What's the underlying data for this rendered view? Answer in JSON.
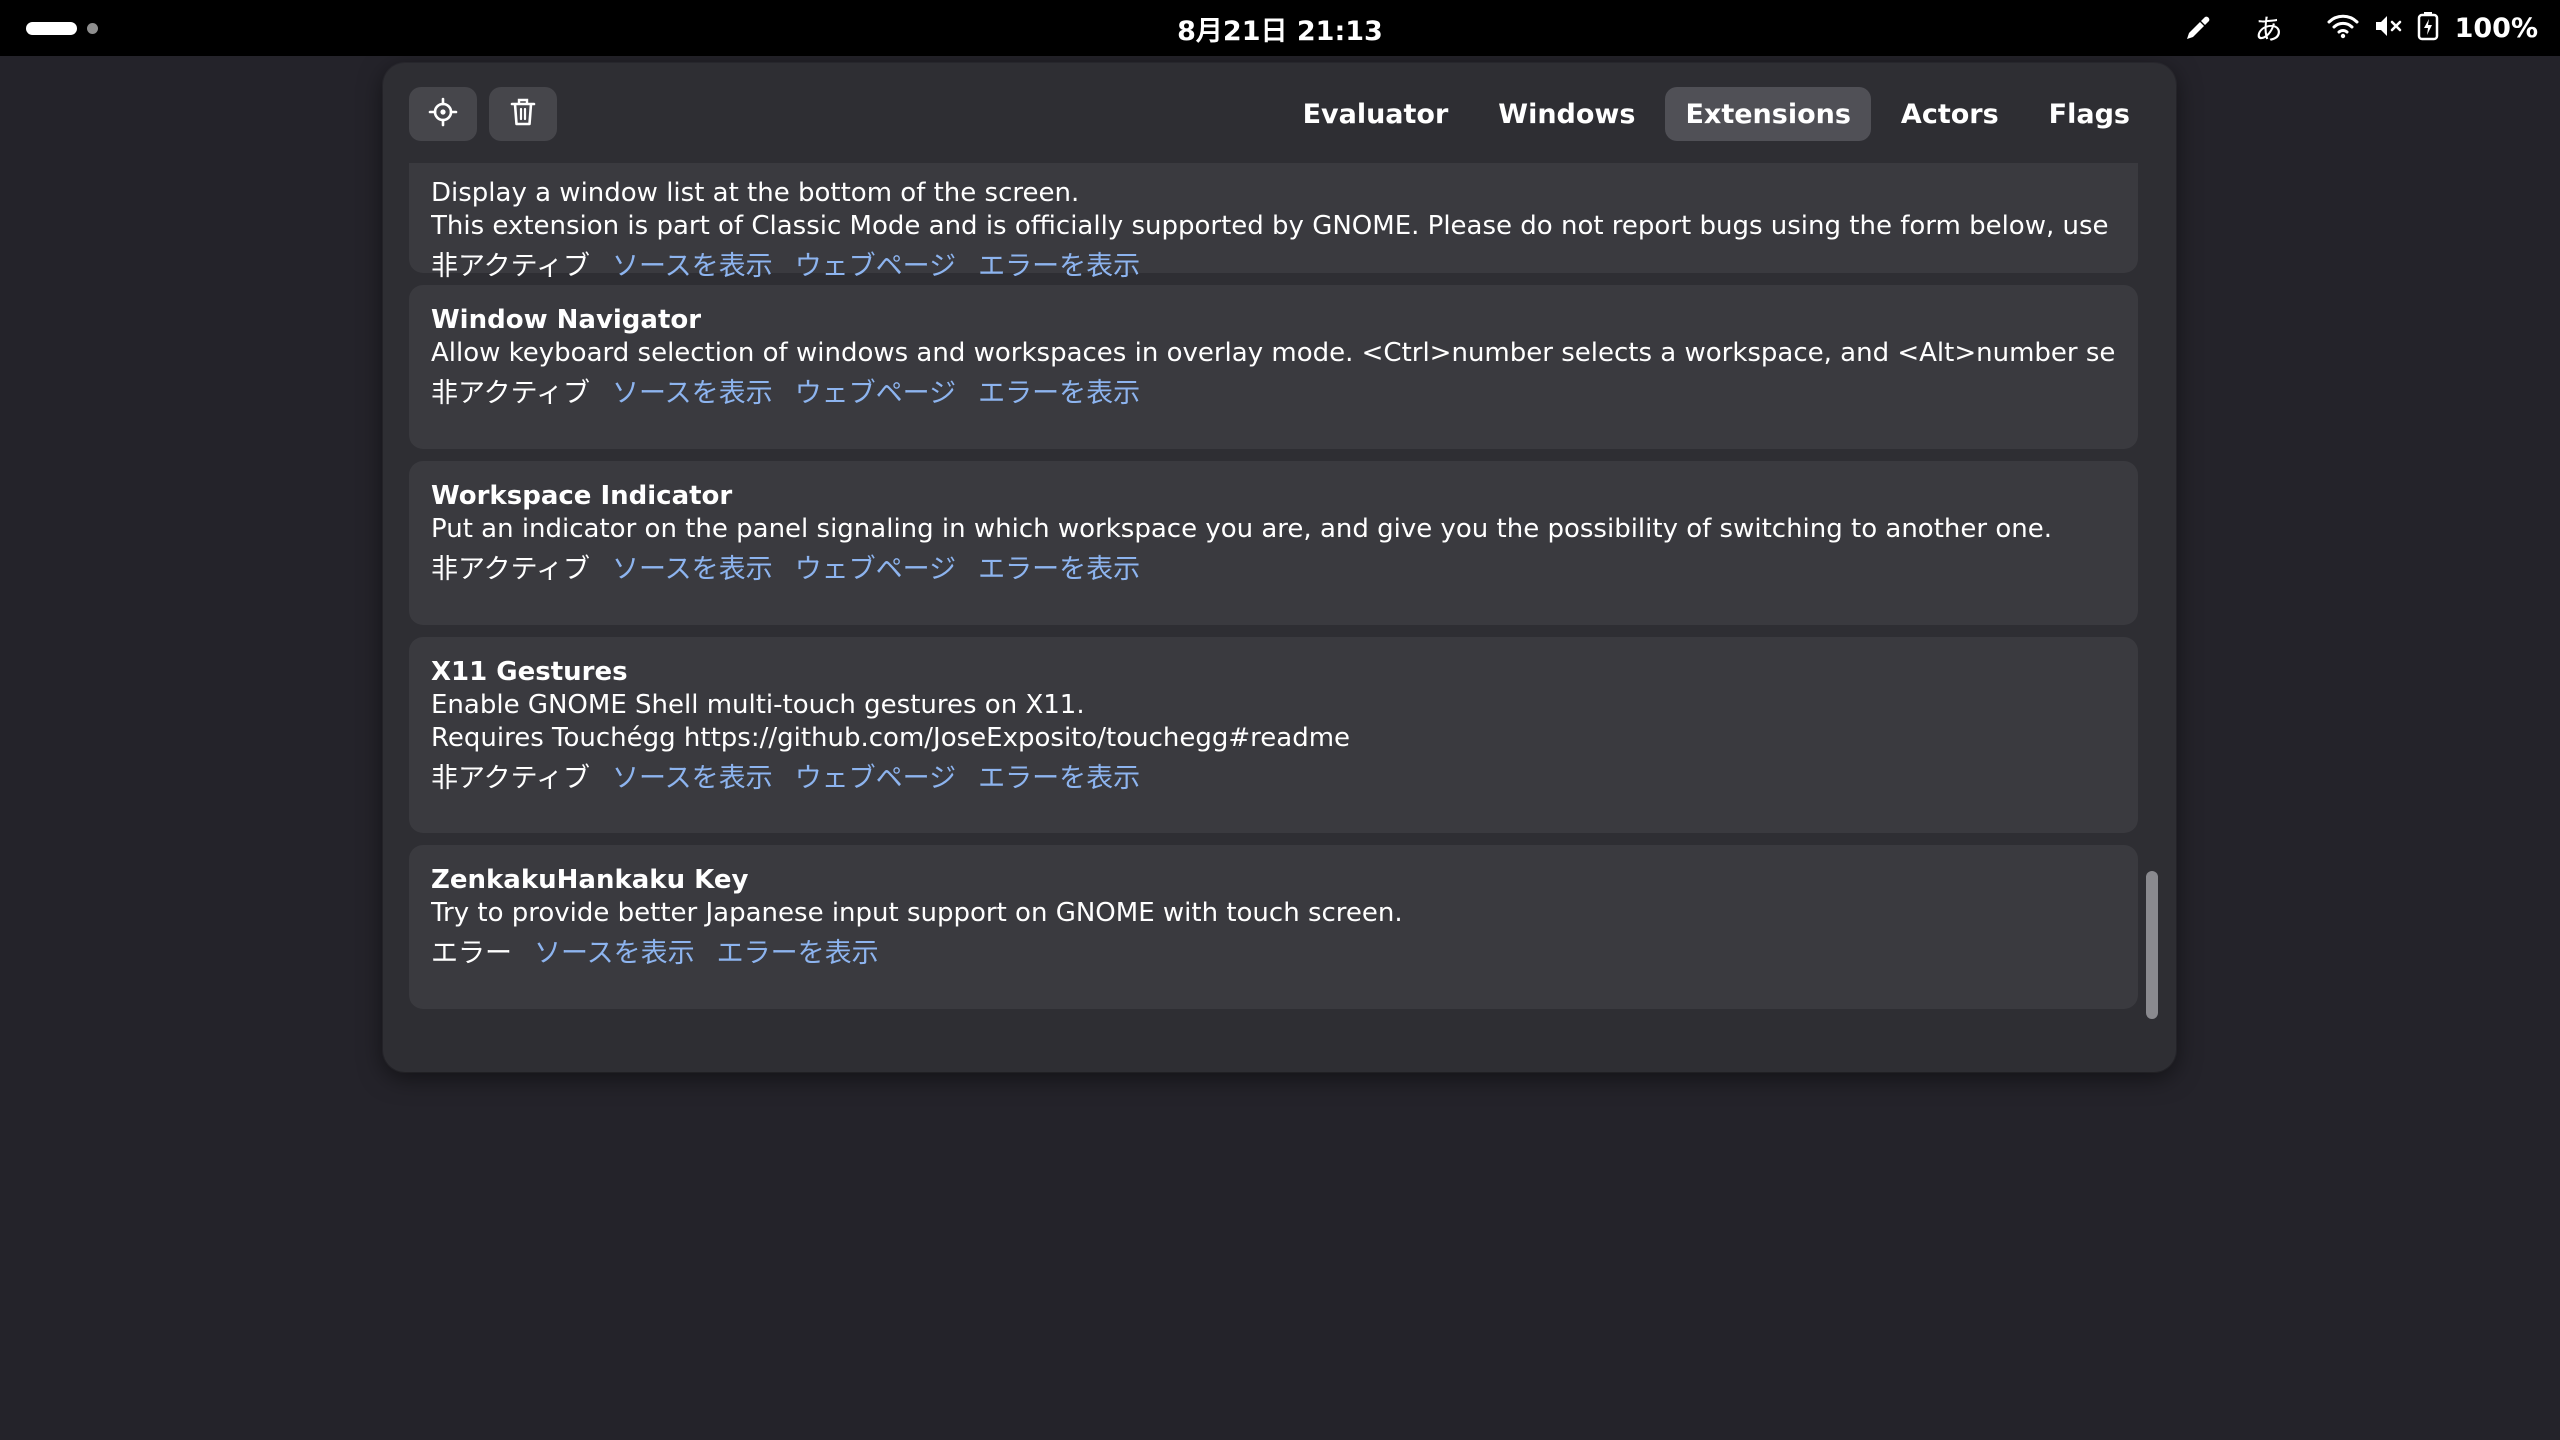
{
  "topbar": {
    "clock": "8月21日  21:13",
    "ime_indicator": "あ",
    "battery_percent": "100%",
    "icons": [
      "workspace-indicator",
      "color-picker-icon",
      "wifi-icon",
      "volume-muted-icon",
      "battery-charging-icon"
    ]
  },
  "lg": {
    "toolbar": {
      "picker_icon": "crosshair-icon",
      "clear_icon": "trash-icon"
    },
    "tabs": [
      {
        "label": "Evaluator"
      },
      {
        "label": "Windows"
      },
      {
        "label": "Extensions",
        "active": true
      },
      {
        "label": "Actors"
      },
      {
        "label": "Flags"
      }
    ],
    "extensions": [
      {
        "title": "",
        "desc1": "Display a window list at the bottom of the screen.",
        "desc2": "This extension is part of Classic Mode and is officially supported by GNOME. Please do not report bugs using the form below, use GNOME's ...",
        "state": "非アクティブ",
        "view_source": "ソースを表示",
        "webpage": "ウェブページ",
        "show_errors": "エラーを表示"
      },
      {
        "title": "Window Navigator",
        "desc1": "Allow keyboard selection of windows and workspaces in overlay mode. <Ctrl>number selects a workspace, and <Alt>number selects a windo...",
        "state": "非アクティブ",
        "view_source": "ソースを表示",
        "webpage": "ウェブページ",
        "show_errors": "エラーを表示"
      },
      {
        "title": "Workspace Indicator",
        "desc1": "Put an indicator on the panel signaling in which workspace you are, and give you the possibility of switching to another one.",
        "state": "非アクティブ",
        "view_source": "ソースを表示",
        "webpage": "ウェブページ",
        "show_errors": "エラーを表示"
      },
      {
        "title": "X11 Gestures",
        "desc1": "Enable GNOME Shell multi-touch gestures on X11.",
        "desc2": "Requires Touchégg https://github.com/JoseExposito/touchegg#readme",
        "state": "非アクティブ",
        "view_source": "ソースを表示",
        "webpage": "ウェブページ",
        "show_errors": "エラーを表示"
      },
      {
        "title": "ZenkakuHankaku Key",
        "desc1": "Try to provide better Japanese input support on GNOME with touch screen.",
        "state": "エラー",
        "view_source": "ソースを表示",
        "show_errors": "エラーを表示"
      }
    ],
    "colors": {
      "link": "#8db4ef",
      "card_bg": "#3a3a3f",
      "window_bg": "#2e2e33",
      "desktop_bg": "#24232a"
    }
  }
}
